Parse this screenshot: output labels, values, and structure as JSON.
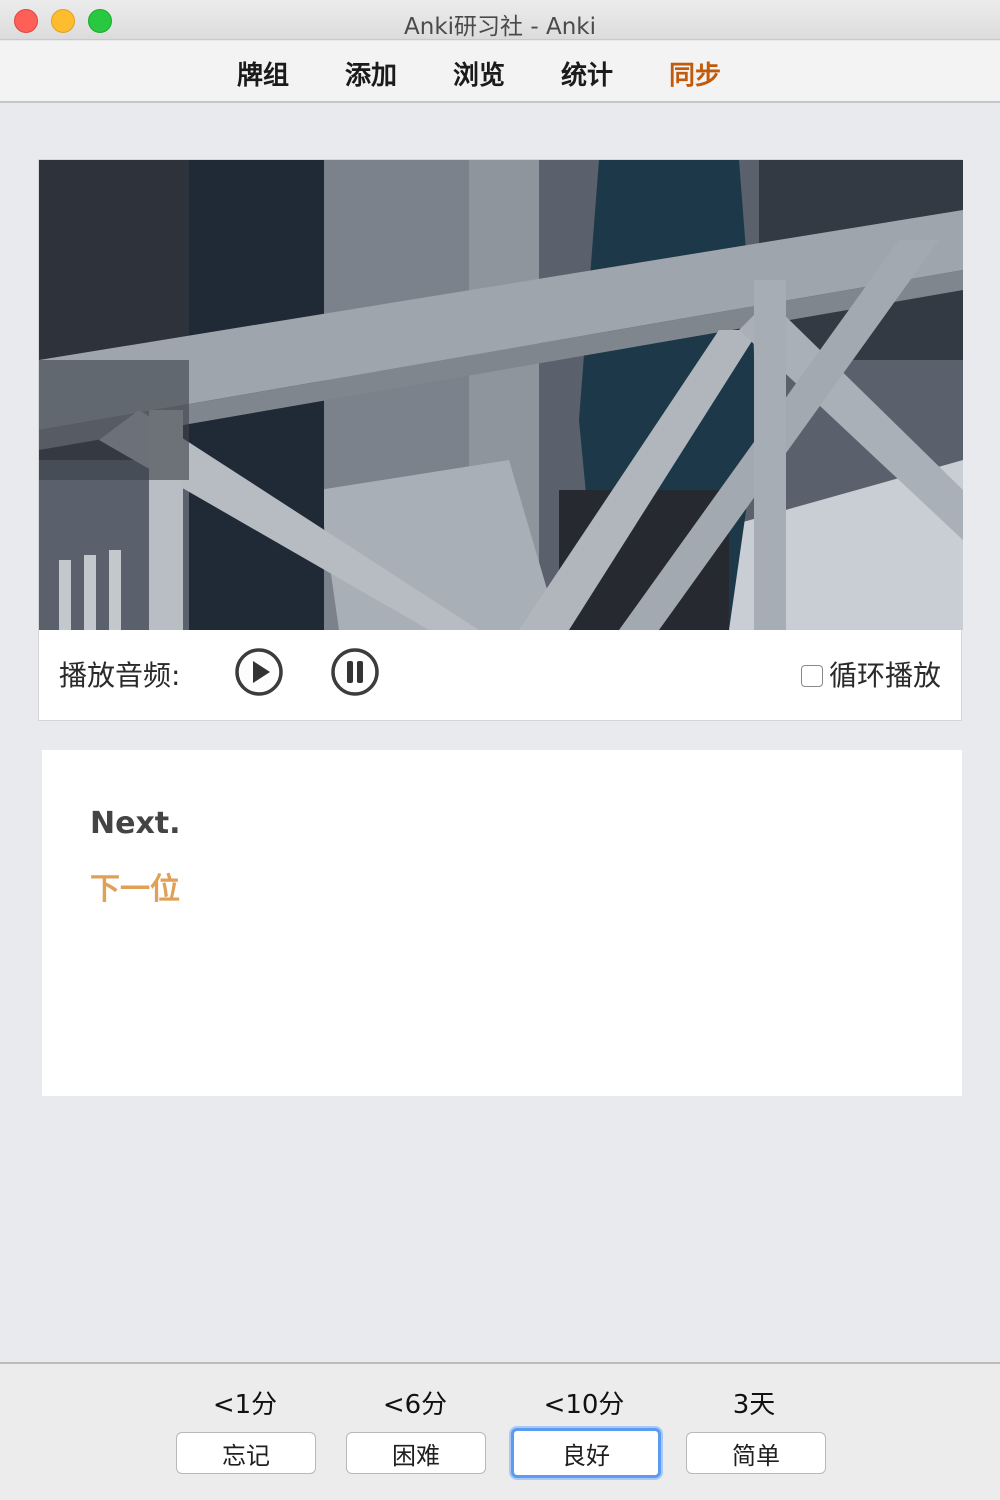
{
  "window": {
    "title": "Anki研习社 - Anki"
  },
  "toolbar": {
    "tabs": [
      {
        "label": "牌组"
      },
      {
        "label": "添加"
      },
      {
        "label": "浏览"
      },
      {
        "label": "统计"
      },
      {
        "label": "同步"
      }
    ]
  },
  "media": {
    "audio_label": "播放音频:",
    "loop_label": "循环播放",
    "loop_checked": false
  },
  "answer": {
    "english": "Next.",
    "chinese": "下一位"
  },
  "review": {
    "intervals": [
      "<1分",
      "<6分",
      "<10分",
      "3天"
    ],
    "buttons": [
      "忘记",
      "困难",
      "良好",
      "简单"
    ]
  },
  "colors": {
    "sync_tab": "#c25a0b",
    "chinese_text": "#e0a056",
    "focus_ring": "#5b9bf2"
  }
}
